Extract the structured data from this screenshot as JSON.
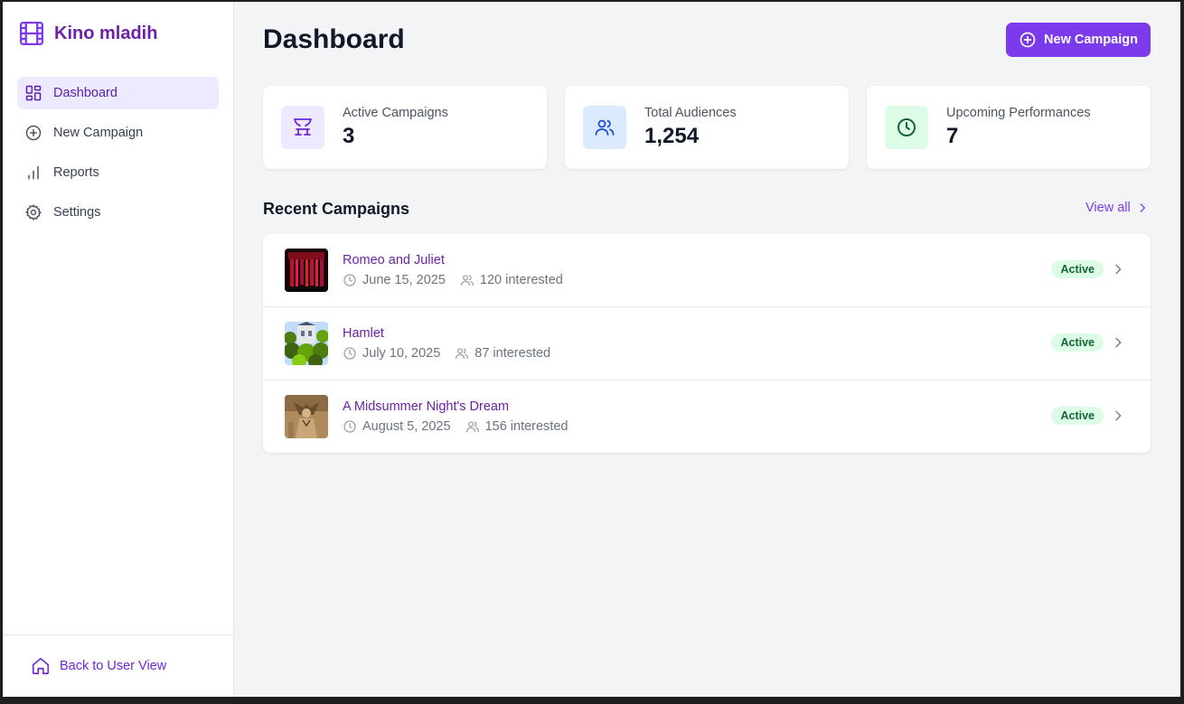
{
  "app": {
    "brand_name": "Kino mladih",
    "brand_color": "#6b21a8",
    "accent": "#7c3aed"
  },
  "sidebar": {
    "items": [
      {
        "label": "Dashboard",
        "icon": "dashboard-icon",
        "active": true
      },
      {
        "label": "New Campaign",
        "icon": "plus-circle-icon",
        "active": false
      },
      {
        "label": "Reports",
        "icon": "bar-chart-icon",
        "active": false
      },
      {
        "label": "Settings",
        "icon": "gear-icon",
        "active": false
      }
    ],
    "footer_label": "Back to User View"
  },
  "header": {
    "title": "Dashboard",
    "new_campaign_label": "New Campaign"
  },
  "stats": [
    {
      "label": "Active Campaigns",
      "value": "3",
      "icon": "theater-icon"
    },
    {
      "label": "Total Audiences",
      "value": "1,254",
      "icon": "users-icon"
    },
    {
      "label": "Upcoming Performances",
      "value": "7",
      "icon": "clock-icon"
    }
  ],
  "recent": {
    "title": "Recent Campaigns",
    "view_all_label": "View all",
    "campaigns": [
      {
        "title": "Romeo and Juliet",
        "date": "June 15, 2025",
        "interested": "120 interested",
        "status": "Active"
      },
      {
        "title": "Hamlet",
        "date": "July 10, 2025",
        "interested": "87 interested",
        "status": "Active"
      },
      {
        "title": "A Midsummer Night's Dream",
        "date": "August 5, 2025",
        "interested": "156 interested",
        "status": "Active"
      }
    ]
  }
}
